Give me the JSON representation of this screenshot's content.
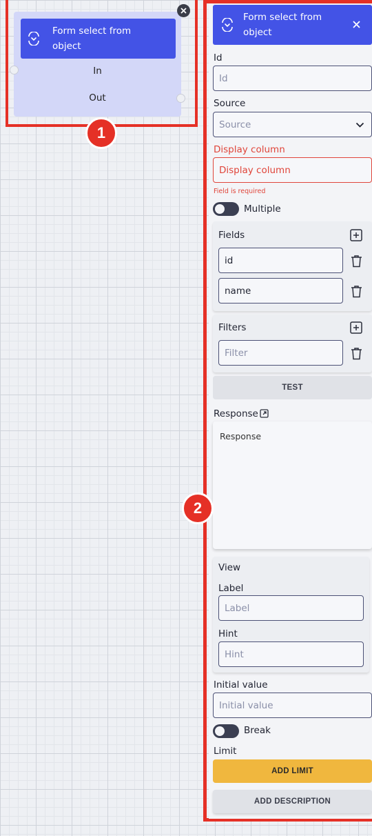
{
  "node": {
    "title": "Form select from object",
    "port_in": "In",
    "port_out": "Out",
    "badge": "1"
  },
  "panel": {
    "badge": "2",
    "title": "Form select from object",
    "id_label": "Id",
    "id_placeholder": "Id",
    "source_label": "Source",
    "source_placeholder": "Source",
    "display_label": "Display column",
    "display_placeholder": "Display column",
    "display_error": "Field is required",
    "multiple_label": "Multiple",
    "fields_label": "Fields",
    "fields": [
      "id",
      "name"
    ],
    "filters_label": "Filters",
    "filter_placeholder": "Filter",
    "test_label": "TEST",
    "response_label": "Response",
    "response_placeholder": "Response",
    "view_label": "View",
    "label_label": "Label",
    "label_placeholder": "Label",
    "hint_label": "Hint",
    "hint_placeholder": "Hint",
    "initial_label": "Initial value",
    "initial_placeholder": "Initial value",
    "break_label": "Break",
    "limit_label": "Limit",
    "add_limit_label": "ADD LIMIT",
    "add_description_label": "ADD DESCRIPTION"
  },
  "colors": {
    "header_blue": "#4353e6",
    "node_body": "#d3d7f8",
    "highlight_red": "#e53026",
    "button_yellow": "#f0b73e",
    "error_red": "#e0453a"
  },
  "icons": [
    "form-select-icon",
    "close-icon",
    "chevron-down-icon",
    "add-box-icon",
    "trash-icon",
    "expand-icon"
  ]
}
